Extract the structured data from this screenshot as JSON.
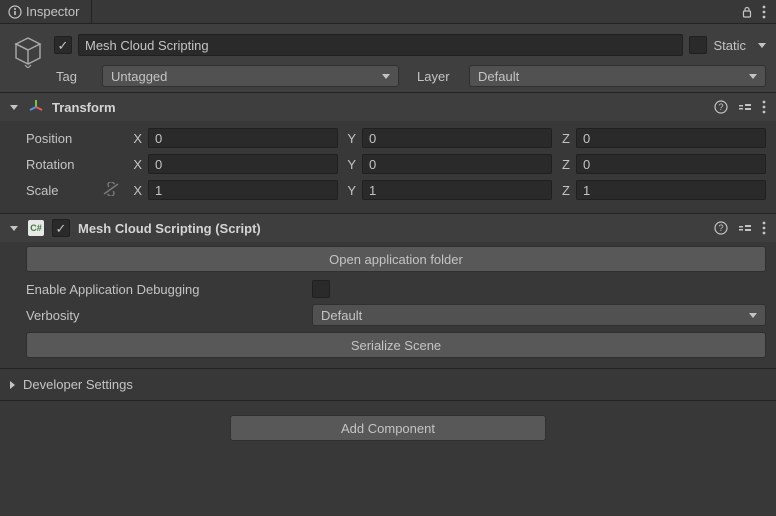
{
  "tab": {
    "title": "Inspector"
  },
  "header": {
    "name": "Mesh Cloud Scripting",
    "active": true,
    "static_label": "Static",
    "static": false,
    "tag_label": "Tag",
    "tag_value": "Untagged",
    "layer_label": "Layer",
    "layer_value": "Default"
  },
  "transform": {
    "title": "Transform",
    "position_label": "Position",
    "rotation_label": "Rotation",
    "scale_label": "Scale",
    "axes": {
      "x": "X",
      "y": "Y",
      "z": "Z"
    },
    "position": {
      "x": "0",
      "y": "0",
      "z": "0"
    },
    "rotation": {
      "x": "0",
      "y": "0",
      "z": "0"
    },
    "scale": {
      "x": "1",
      "y": "1",
      "z": "1"
    }
  },
  "script": {
    "title": "Mesh Cloud Scripting (Script)",
    "enabled": true,
    "open_folder_label": "Open application folder",
    "enable_debug_label": "Enable Application Debugging",
    "enable_debug": false,
    "verbosity_label": "Verbosity",
    "verbosity_value": "Default",
    "serialize_label": "Serialize Scene"
  },
  "developer": {
    "title": "Developer Settings"
  },
  "add_component_label": "Add Component"
}
